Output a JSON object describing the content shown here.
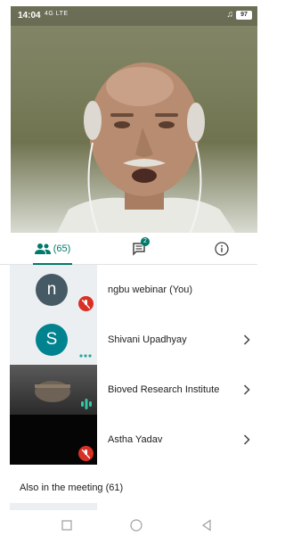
{
  "status_bar": {
    "time": "14:04",
    "network": "4G LTE",
    "battery": "97"
  },
  "tabs": {
    "people_count": "(65)",
    "chat_badge": "2"
  },
  "participants": [
    {
      "name": "ngbu webinar (You)",
      "initial": "n",
      "avatar_color": "#455a64",
      "status": "muted"
    },
    {
      "name": "Shivani Upadhyay",
      "initial": "S",
      "avatar_color": "#00838f",
      "status": "connecting"
    },
    {
      "name": "Bioved Research Institute",
      "status": "speaking"
    },
    {
      "name": "Astha Yadav",
      "status": "muted"
    }
  ],
  "also_in_meeting": "Also in the meeting (61)",
  "colors": {
    "accent": "#00796b",
    "muted": "#d93025"
  }
}
